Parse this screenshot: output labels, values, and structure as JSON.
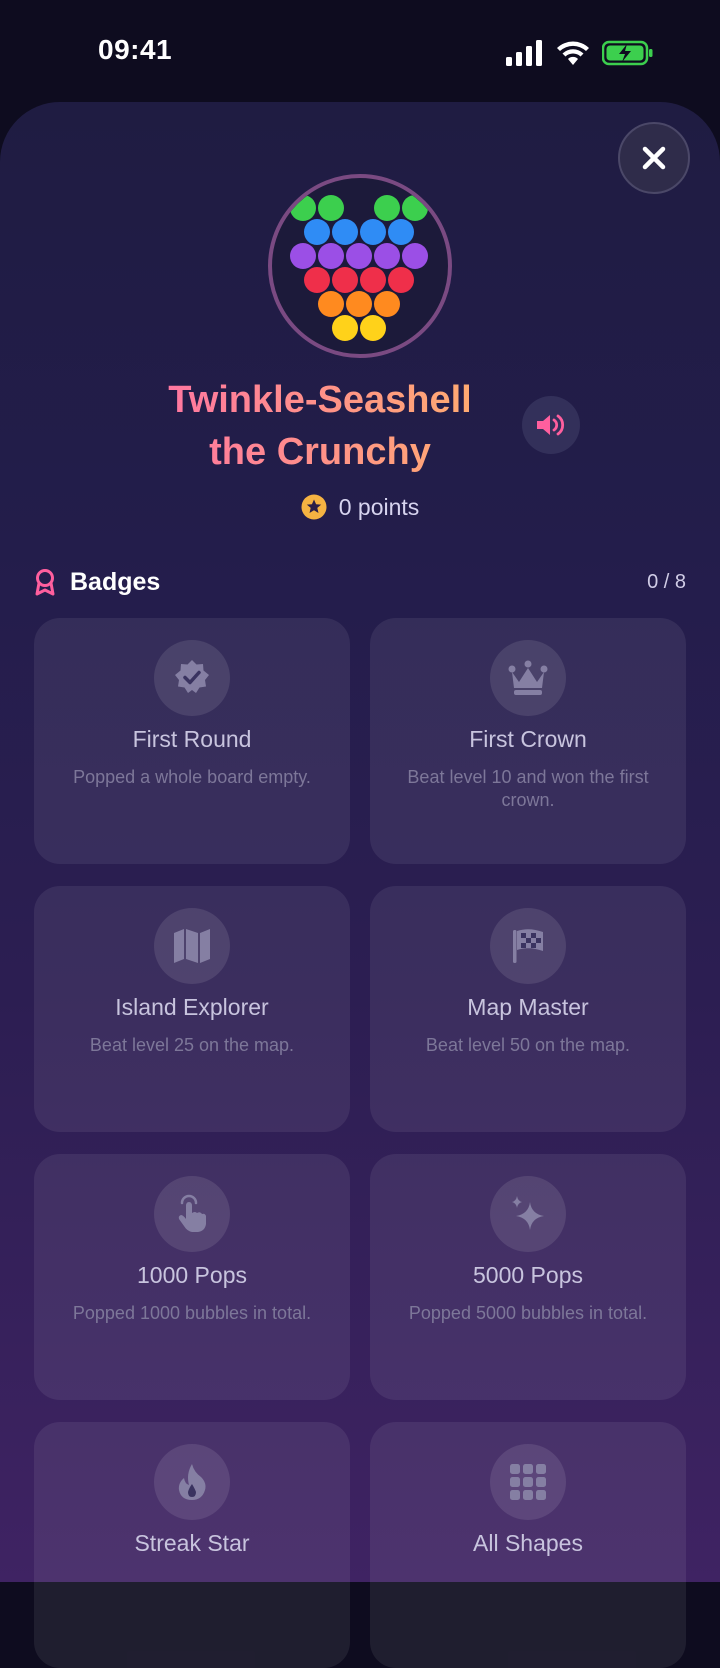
{
  "status_bar": {
    "time": "09:41"
  },
  "profile": {
    "name_line1": "Twinkle-Seashell",
    "name_line2": "the Crunchy",
    "points_label": "0 points"
  },
  "badges": {
    "title": "Badges",
    "count": "0 / 8",
    "items": [
      {
        "title": "First Round",
        "desc": "Popped a whole board empty.",
        "icon": "verified-badge-icon"
      },
      {
        "title": "First Crown",
        "desc": "Beat level 10 and won the first crown.",
        "icon": "crown-icon"
      },
      {
        "title": "Island Explorer",
        "desc": "Beat level 25 on the map.",
        "icon": "map-icon"
      },
      {
        "title": "Map Master",
        "desc": "Beat level 50 on the map.",
        "icon": "checkered-flag-icon"
      },
      {
        "title": "1000 Pops",
        "desc": "Popped 1000 bubbles in total.",
        "icon": "tap-hand-icon"
      },
      {
        "title": "5000 Pops",
        "desc": "Popped 5000 bubbles in total.",
        "icon": "sparkles-icon"
      },
      {
        "title": "Streak Star",
        "desc": "",
        "icon": "flame-icon"
      },
      {
        "title": "All Shapes",
        "desc": "",
        "icon": "grid-icon"
      }
    ]
  },
  "colors": {
    "name_gradient_start": "#ff6fa8",
    "name_gradient_end": "#ffb36a",
    "points_star": "#f5b342",
    "badge_accent": "#ff5f9e",
    "battery": "#3ccf4e"
  }
}
